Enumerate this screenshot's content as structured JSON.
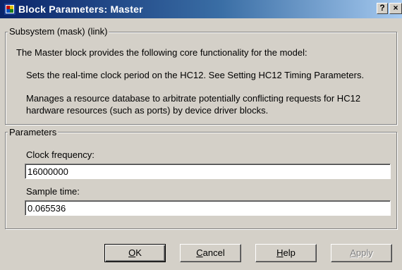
{
  "window": {
    "title": "Block Parameters: Master",
    "help_button": "?",
    "close_button": "×"
  },
  "subsystem": {
    "label": "Subsystem (mask) (link)",
    "description": [
      "The Master block provides the following core functionality for the model:",
      "Sets the real-time clock period on the HC12. See Setting HC12 Timing Parameters.",
      "Manages a resource database to arbitrate potentially conflicting requests for HC12",
      "hardware resources (such as ports) by device driver blocks."
    ]
  },
  "parameters": {
    "label": "Parameters",
    "clock_frequency": {
      "label": "Clock frequency:",
      "value": "16000000"
    },
    "sample_time": {
      "label": "Sample time:",
      "value": "0.065536"
    }
  },
  "buttons": {
    "ok": {
      "mnemonic": "O",
      "rest": "K"
    },
    "cancel": {
      "mnemonic": "C",
      "rest": "ancel"
    },
    "help": {
      "mnemonic": "H",
      "rest": "elp"
    },
    "apply": {
      "mnemonic": "A",
      "rest": "pply"
    }
  },
  "colors": {
    "title_start": "#0a246a",
    "title_end": "#a6caf0",
    "face": "#d4d0c8"
  }
}
